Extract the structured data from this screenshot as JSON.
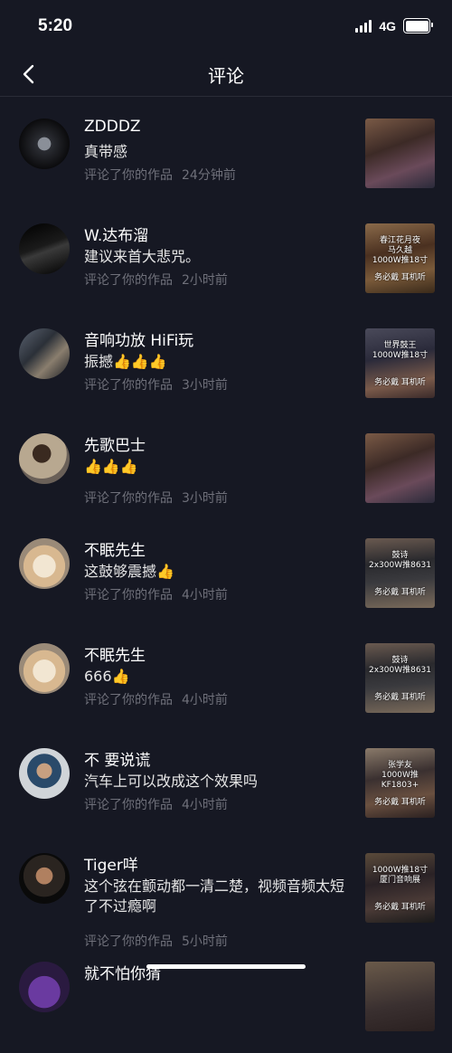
{
  "status": {
    "time": "5:20",
    "network": "4G"
  },
  "nav": {
    "title": "评论"
  },
  "comments": [
    {
      "user": "ZDDDZ",
      "text": "真带感",
      "action": "评论了你的作品",
      "time": "24分钟前",
      "thumb_caption": "",
      "thumb_sub": ""
    },
    {
      "user": "W.达布溜",
      "text": "建议来首大悲咒。",
      "action": "评论了你的作品",
      "time": "2小时前",
      "thumb_caption": "春江花月夜\n马久越\n1000W推18寸",
      "thumb_sub": "务必戴 耳机听"
    },
    {
      "user": "音响功放 HiFi玩",
      "text": "振撼👍👍👍",
      "action": "评论了你的作品",
      "time": "3小时前",
      "thumb_caption": "世界鼓王\n1000W推18寸",
      "thumb_sub": "务必戴 耳机听"
    },
    {
      "user": "先歌巴士",
      "text": "👍👍👍",
      "action": "评论了你的作品",
      "time": "3小时前",
      "thumb_caption": "",
      "thumb_sub": ""
    },
    {
      "user": "不眠先生",
      "text": "这鼓够震撼👍",
      "action": "评论了你的作品",
      "time": "4小时前",
      "thumb_caption": "鼓诗\n2x300W推8631",
      "thumb_sub": "务必戴 耳机听"
    },
    {
      "user": "不眠先生",
      "text": "666👍",
      "action": "评论了你的作品",
      "time": "4小时前",
      "thumb_caption": "鼓诗\n2x300W推8631",
      "thumb_sub": "务必戴 耳机听"
    },
    {
      "user": "不 要说谎",
      "text": "汽车上可以改成这个效果吗",
      "action": "评论了你的作品",
      "time": "4小时前",
      "thumb_caption": "张学友\n1000W推KF1803+",
      "thumb_sub": "务必戴 耳机听"
    },
    {
      "user": "Tiger咩",
      "text": "这个弦在颤动都一清二楚，视频音频太短了不过瘾啊",
      "action": "评论了你的作品",
      "time": "5小时前",
      "thumb_caption": "1000W推18寸\n厦门音响展",
      "thumb_sub": "务必戴 耳机听"
    },
    {
      "user": "就不怕你猜",
      "text": "",
      "action": "",
      "time": "",
      "thumb_caption": "",
      "thumb_sub": ""
    }
  ],
  "colors": {
    "background": "#161823",
    "meta": "#6f707a",
    "divider": "#2a2c36"
  }
}
